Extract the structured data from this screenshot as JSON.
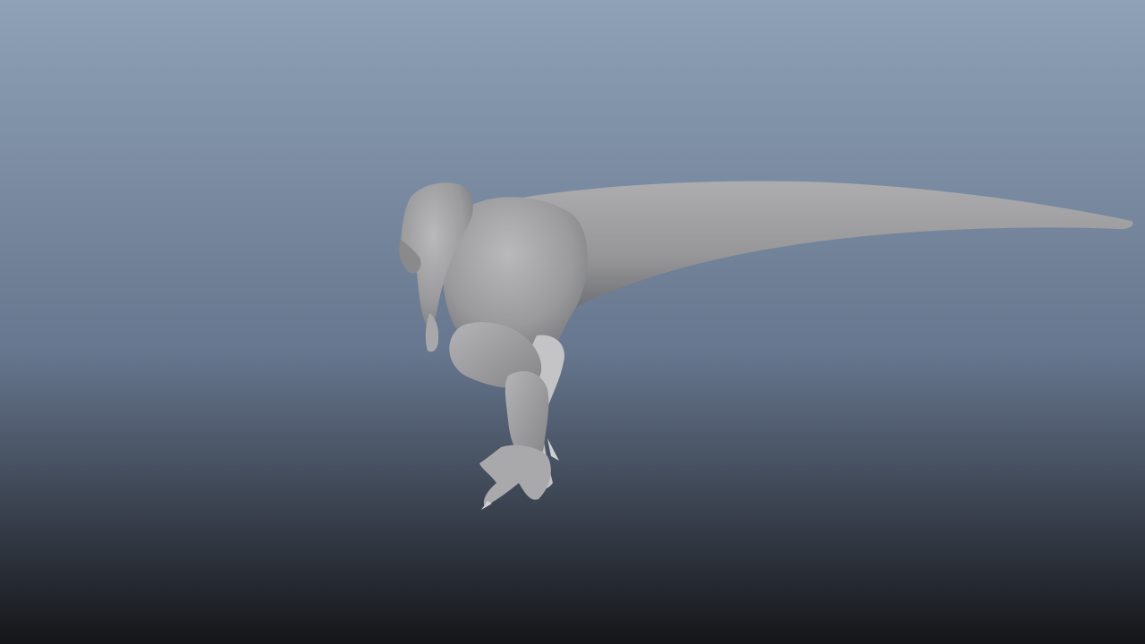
{
  "viewport": {
    "background_top_color": "#8ea1b6",
    "background_mid_color": "#66768e",
    "background_bottom_color": "#141518"
  },
  "model": {
    "subject": "dinosaur-mesh",
    "shading": "smooth-gray",
    "base_color": "#9a9a9c",
    "highlight_color": "#b9b9bb",
    "shadow_color": "#6f7074"
  }
}
